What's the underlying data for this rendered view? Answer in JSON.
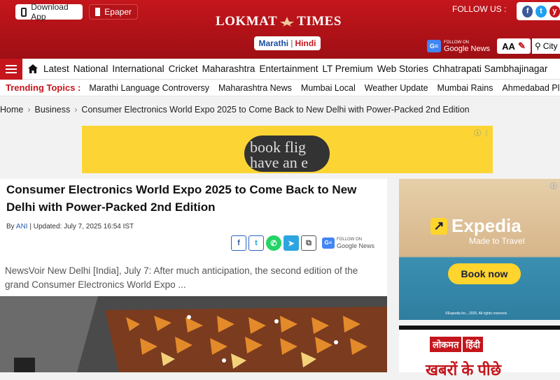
{
  "header": {
    "download_app": "Download App",
    "epaper": "Epaper",
    "logo_left": "LOKMAT",
    "logo_right": "TIMES",
    "lang_marathi": "Marathi",
    "lang_sep": "|",
    "lang_hindi": "Hindi",
    "follow_us": "FOLLOW US :",
    "gnews_top": "FOLLOW ON",
    "gnews_label": "Google News",
    "text_size": "AA",
    "city": "City"
  },
  "nav": {
    "items": [
      "Latest",
      "National",
      "International",
      "Cricket",
      "Maharashtra",
      "Entertainment",
      "LT Premium",
      "Web Stories",
      "Chhatrapati Sambhajinagar"
    ]
  },
  "trending": {
    "label": "Trending Topics :",
    "items": [
      "Marathi Language Controversy",
      "Maharashtra News",
      "Mumbai Local",
      "Weather Update",
      "Mumbai Rains",
      "Ahmedabad Plane C"
    ]
  },
  "breadcrumb": {
    "home": "Home",
    "section": "Business",
    "current": "Consumer Electronics World Expo 2025 to Come Back to New Delhi with Power-Packed 2nd Edition"
  },
  "ad_top": {
    "text": "book flig have an e"
  },
  "article": {
    "title": "Consumer Electronics World Expo 2025 to Come Back to New Delhi with Power-Packed 2nd Edition",
    "by": "By",
    "author": "ANI",
    "updated": "| Updated: July 7, 2025 16:54 IST",
    "excerpt": "NewsVoir New Delhi [India], July 7: After much anticipation, the second edition of the grand Consumer Electronics World Expo ...",
    "gnews_top": "FOLLOW ON",
    "gnews_label": "Google News"
  },
  "side_ad": {
    "brand": "Expedia",
    "tagline": "Made to Travel",
    "cta": "Book now",
    "fine": "©Expedia Inc., 2025. All rights reserved."
  },
  "side_ad2": {
    "brand_a": "लोकमत",
    "brand_b": "हिंदी",
    "headline": "खबरों के पीछे"
  }
}
